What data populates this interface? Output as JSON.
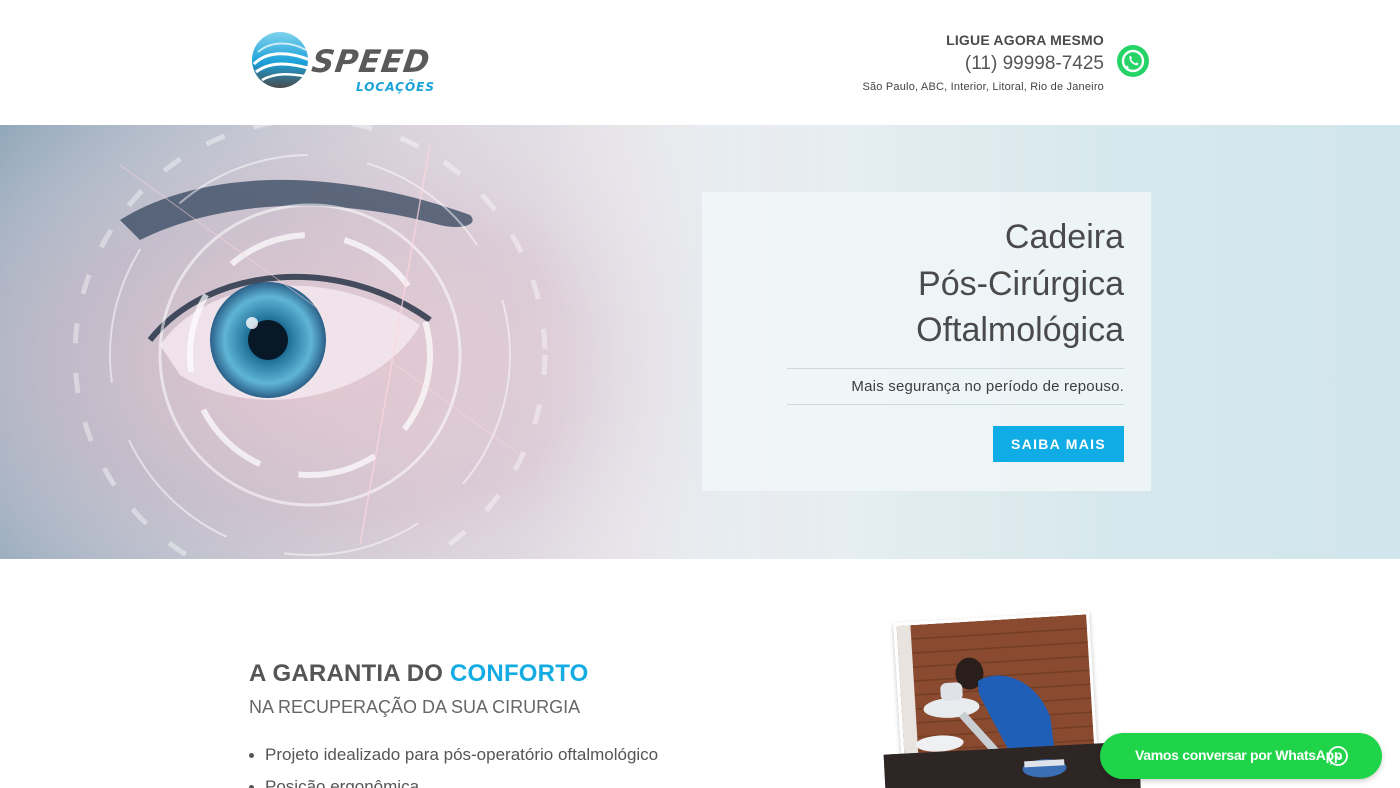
{
  "brand": {
    "logo_word": "SPEED",
    "logo_sub": "LOCAÇÕES"
  },
  "header": {
    "call_label": "LIGUE AGORA MESMO",
    "phone": "(11) 99998-7425",
    "regions": "São Paulo, ABC, Interior, Litoral, Rio de Janeiro",
    "whatsapp_icon": "whatsapp-icon"
  },
  "hero": {
    "title_lines": [
      "Cadeira",
      "Pós-Cirúrgica",
      "Oftalmológica"
    ],
    "subtitle": "Mais segurança no período de repouso.",
    "cta_label": "SAIBA MAIS"
  },
  "content": {
    "title_prefix": "A GARANTIA DO ",
    "title_accent": "CONFORTO",
    "subtitle": "NA RECUPERAÇÃO DA SUA CIRURGIA",
    "features": [
      "Projeto idealizado para pós-operatório oftalmológico",
      "Posição ergonômica"
    ]
  },
  "whatsapp_float": {
    "label": "Vamos conversar por WhatsApp",
    "icon": "whatsapp-icon"
  },
  "colors": {
    "accent": "#10ace6",
    "whatsapp_green": "#1fd449",
    "text": "#4a4a4a"
  }
}
